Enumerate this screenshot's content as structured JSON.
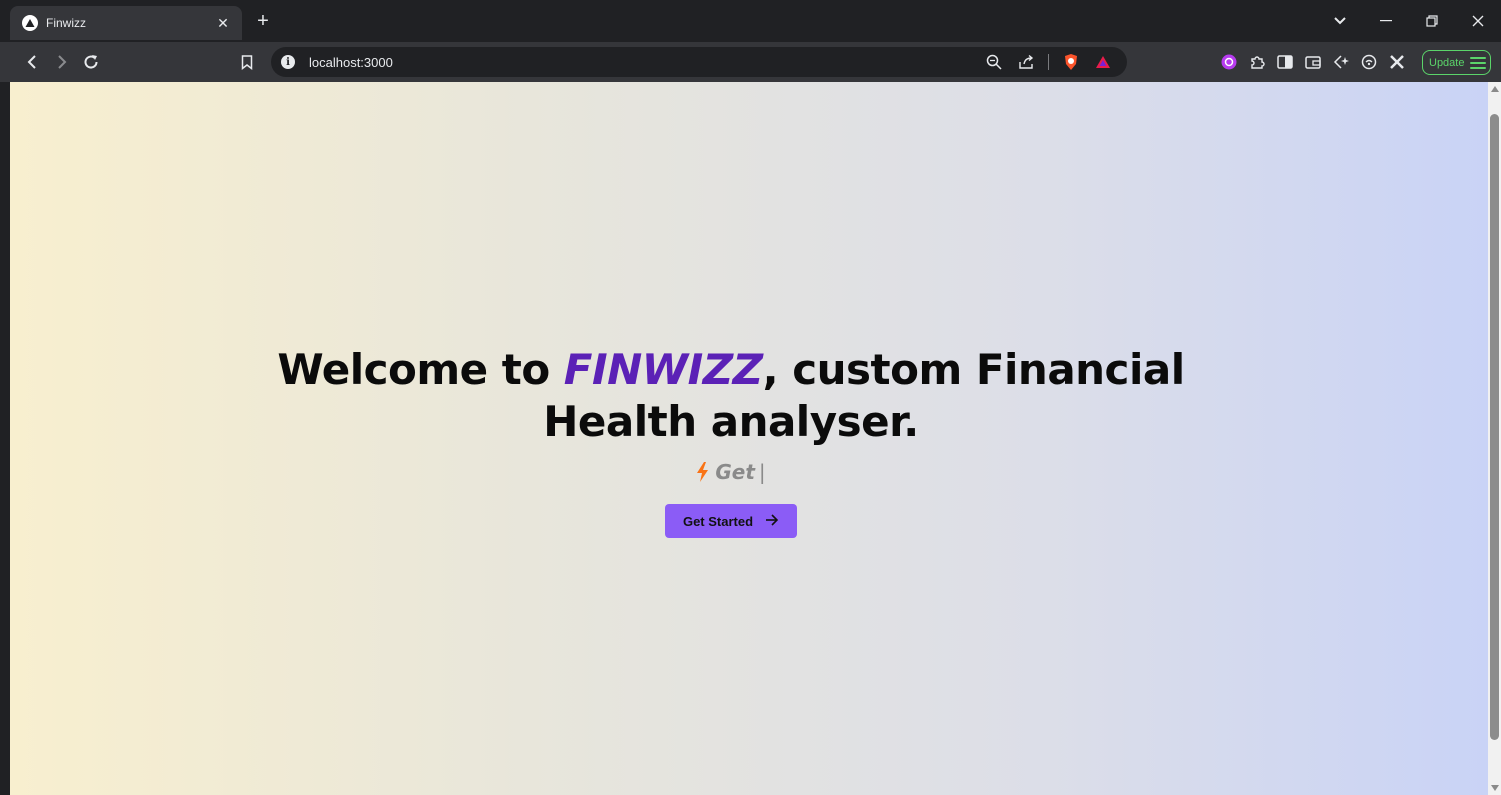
{
  "browser": {
    "tab": {
      "title": "Finwizz"
    },
    "address_bar": {
      "url": "localhost:3000"
    },
    "update_button": {
      "label": "Update"
    },
    "colors": {
      "chrome_dark": "#202124",
      "chrome_toolbar": "#35363a",
      "update_green": "#5bd46a"
    }
  },
  "page": {
    "hero": {
      "title_prefix": "Welcome to ",
      "brand": "FINWIZZ",
      "title_suffix": ", custom Financial",
      "title_line2": "Health analyser.",
      "typed_text": "Get",
      "cursor": "|"
    },
    "cta": {
      "label": "Get Started",
      "icon": "arrow-right-icon"
    },
    "colors": {
      "brand": "#5b21b6",
      "cta_bg": "#8b5cf6",
      "bolt": "#f97316"
    }
  }
}
